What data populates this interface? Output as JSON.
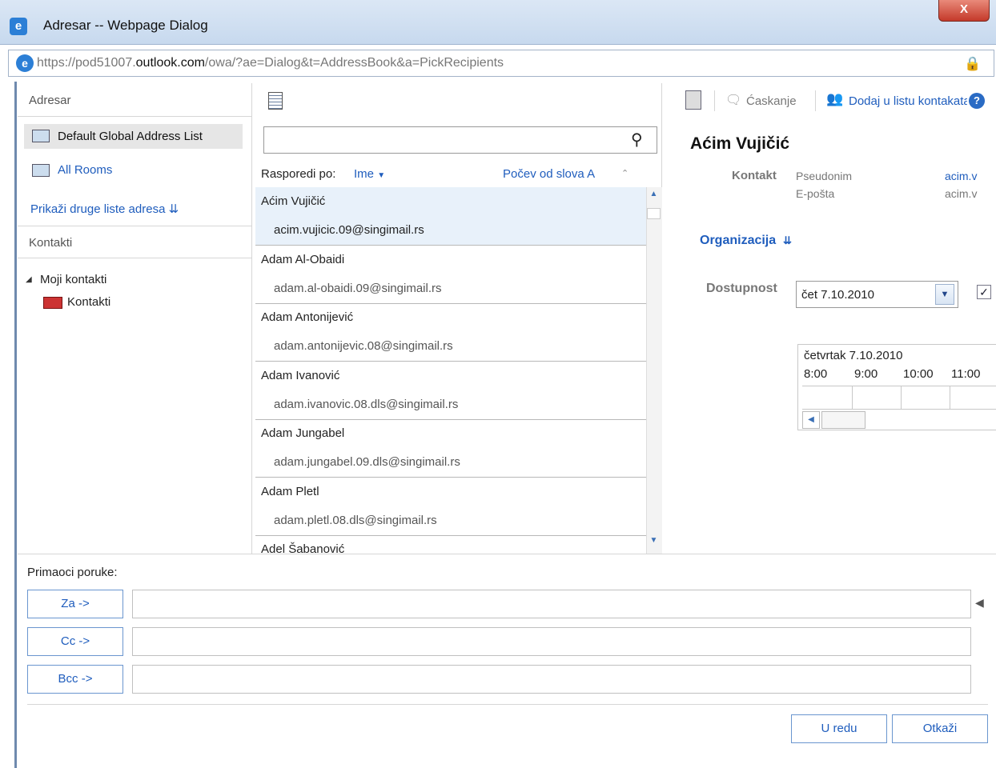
{
  "window": {
    "title": "Adresar -- Webpage Dialog",
    "close_label": "X",
    "url_prefix": "https://pod51007.",
    "url_domain": "outlook.com",
    "url_path": "/owa/?ae=Dialog&t=AddressBook&a=PickRecipients"
  },
  "left": {
    "adresar_header": "Adresar",
    "gal_label": "Default Global Address List",
    "rooms_label": "All Rooms",
    "show_other_label": "Prikaži druge liste adresa",
    "kontakti_header": "Kontakti",
    "tree_root": "Moji kontakti",
    "tree_child": "Kontakti"
  },
  "middle": {
    "search_placeholder": "",
    "sort_label": "Rasporedi po:",
    "sort_value": "Ime",
    "start_label": "Počev od slova A",
    "entries": [
      {
        "name": "Aćim Vujičić",
        "email": "acim.vujicic.09@singimail.rs"
      },
      {
        "name": "Adam Al-Obaidi",
        "email": "adam.al-obaidi.09@singimail.rs"
      },
      {
        "name": "Adam Antonijević",
        "email": "adam.antonijevic.08@singimail.rs"
      },
      {
        "name": "Adam Ivanović",
        "email": "adam.ivanovic.08.dls@singimail.rs"
      },
      {
        "name": "Adam Jungabel",
        "email": "adam.jungabel.09.dls@singimail.rs"
      },
      {
        "name": "Adam Pletl",
        "email": "adam.pletl.08.dls@singimail.rs"
      },
      {
        "name": "Adel Šabanović",
        "email": ""
      }
    ]
  },
  "right": {
    "chat_label": "Ćaskanje",
    "add_contact_label": "Dodaj u listu kontakata",
    "name": "Aćim Vujičić",
    "contact_label": "Kontakt",
    "alias_label": "Pseudonim",
    "email_label": "E-pošta",
    "alias_value": "acim.v",
    "email_value": "acim.v",
    "org_label": "Organizacija",
    "availability_label": "Dostupnost",
    "date_select": "čet 7.10.2010",
    "schedule_date": "četvrtak 7.10.2010",
    "hours": [
      "8:00",
      "9:00",
      "10:00",
      "11:00"
    ]
  },
  "recipients": {
    "label": "Primaoci poruke:",
    "to_label": "Za ->",
    "cc_label": "Cc ->",
    "bcc_label": "Bcc ->"
  },
  "footer": {
    "ok_label": "U redu",
    "cancel_label": "Otkaži"
  }
}
